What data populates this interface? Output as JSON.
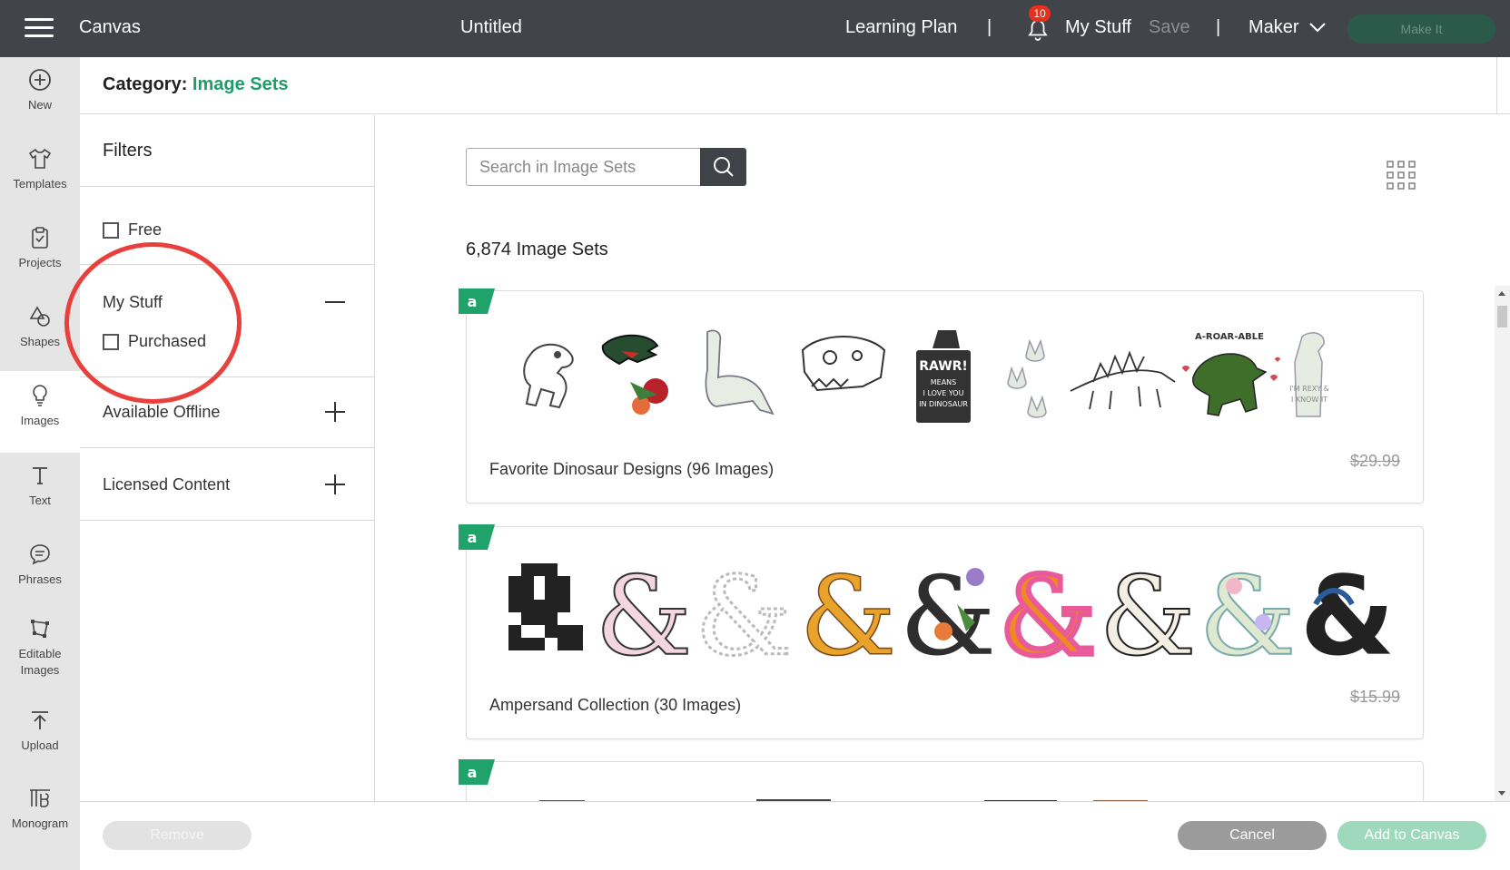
{
  "topbar": {
    "app_label": "Canvas",
    "document_title": "Untitled",
    "learning_plan": "Learning Plan",
    "separator": "|",
    "notification_count": "10",
    "my_stuff": "My Stuff",
    "save": "Save",
    "machine": "Maker",
    "make_it": "Make It",
    "bar_color": "#414549"
  },
  "rail": {
    "items": [
      {
        "label": "New",
        "icon": "plus-circle-icon"
      },
      {
        "label": "Templates",
        "icon": "shirt-icon"
      },
      {
        "label": "Projects",
        "icon": "clipboard-icon"
      },
      {
        "label": "Shapes",
        "icon": "shapes-icon"
      },
      {
        "label": "Images",
        "icon": "lightbulb-icon",
        "active": true
      },
      {
        "label": "Text",
        "icon": "text-icon"
      },
      {
        "label": "Phrases",
        "icon": "speech-bubble-icon"
      },
      {
        "label": "Editable",
        "label2": "Images",
        "icon": "editable-images-icon"
      },
      {
        "label": "Upload",
        "icon": "upload-icon"
      },
      {
        "label": "Monogram",
        "icon": "monogram-icon"
      }
    ]
  },
  "category": {
    "label": "Category:",
    "value": "Image Sets",
    "accent": "#1f9d69"
  },
  "filters": {
    "title": "Filters",
    "free": "Free",
    "my_stuff": "My Stuff",
    "purchased": "Purchased",
    "available_offline": "Available Offline",
    "licensed_content": "Licensed Content"
  },
  "search": {
    "placeholder": "Search in Image Sets",
    "value": ""
  },
  "results": {
    "count_label": "6,874 Image Sets",
    "cards": [
      {
        "name": "Favorite Dinosaur Designs (96 Images)",
        "price": "$29.99",
        "badge": "a"
      },
      {
        "name": "Ampersand Collection (30 Images)",
        "price": "$15.99",
        "badge": "a"
      },
      {
        "name": "",
        "price": "",
        "badge": "a"
      }
    ]
  },
  "footer": {
    "remove": "Remove",
    "cancel": "Cancel",
    "add_to_canvas": "Add to Canvas"
  }
}
